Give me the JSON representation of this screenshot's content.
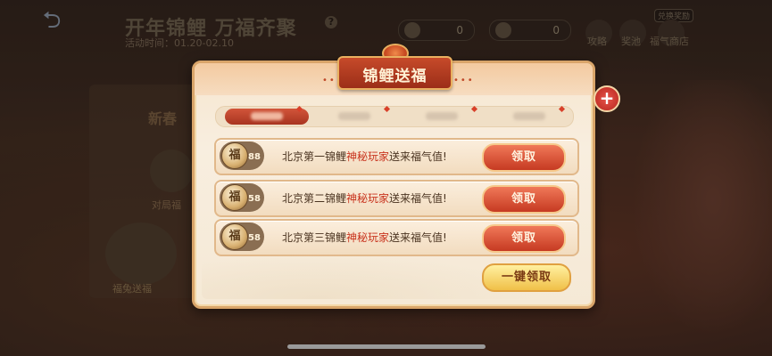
{
  "header": {
    "back_icon": "back-arrow-icon",
    "title": "开年锦鲤 万福齐聚",
    "help_icon": "question-icon",
    "event_time": "活动时间：01.20-02.10"
  },
  "counters": [
    {
      "icon": "coin-icon",
      "value": "0"
    },
    {
      "icon": "coin-icon",
      "value": "0"
    }
  ],
  "top_nav": {
    "items": [
      {
        "label": "攻略",
        "icon": "guide-icon"
      },
      {
        "label": "奖池",
        "icon": "prize-pool-icon"
      },
      {
        "label": "福气商店",
        "icon": "shop-icon"
      }
    ],
    "exchange_badge": "兑换奖励"
  },
  "side": {
    "section_title": "新春",
    "label1": "对局福",
    "label2": "福兔送福"
  },
  "modal": {
    "title": "锦鲤送福",
    "close_icon": "close-plus-icon",
    "tabs": [
      {
        "active": true
      },
      {
        "active": false
      },
      {
        "active": false
      },
      {
        "active": false
      }
    ],
    "rows": [
      {
        "coin_glyph": "福",
        "value": "88",
        "prefix": "北京第一锦鲤",
        "highlight": "神秘玩家",
        "suffix": "送来福气值!",
        "claim_label": "领取"
      },
      {
        "coin_glyph": "福",
        "value": "58",
        "prefix": "北京第二锦鲤",
        "highlight": "神秘玩家",
        "suffix": "送来福气值!",
        "claim_label": "领取"
      },
      {
        "coin_glyph": "福",
        "value": "58",
        "prefix": "北京第三锦鲤",
        "highlight": "神秘玩家",
        "suffix": "送来福气值!",
        "claim_label": "领取"
      }
    ],
    "claim_all_label": "一键领取"
  },
  "colors": {
    "accent_red": "#c8321c",
    "modal_bg": "#f6e6cf",
    "claim_gold": "#f0c048"
  }
}
